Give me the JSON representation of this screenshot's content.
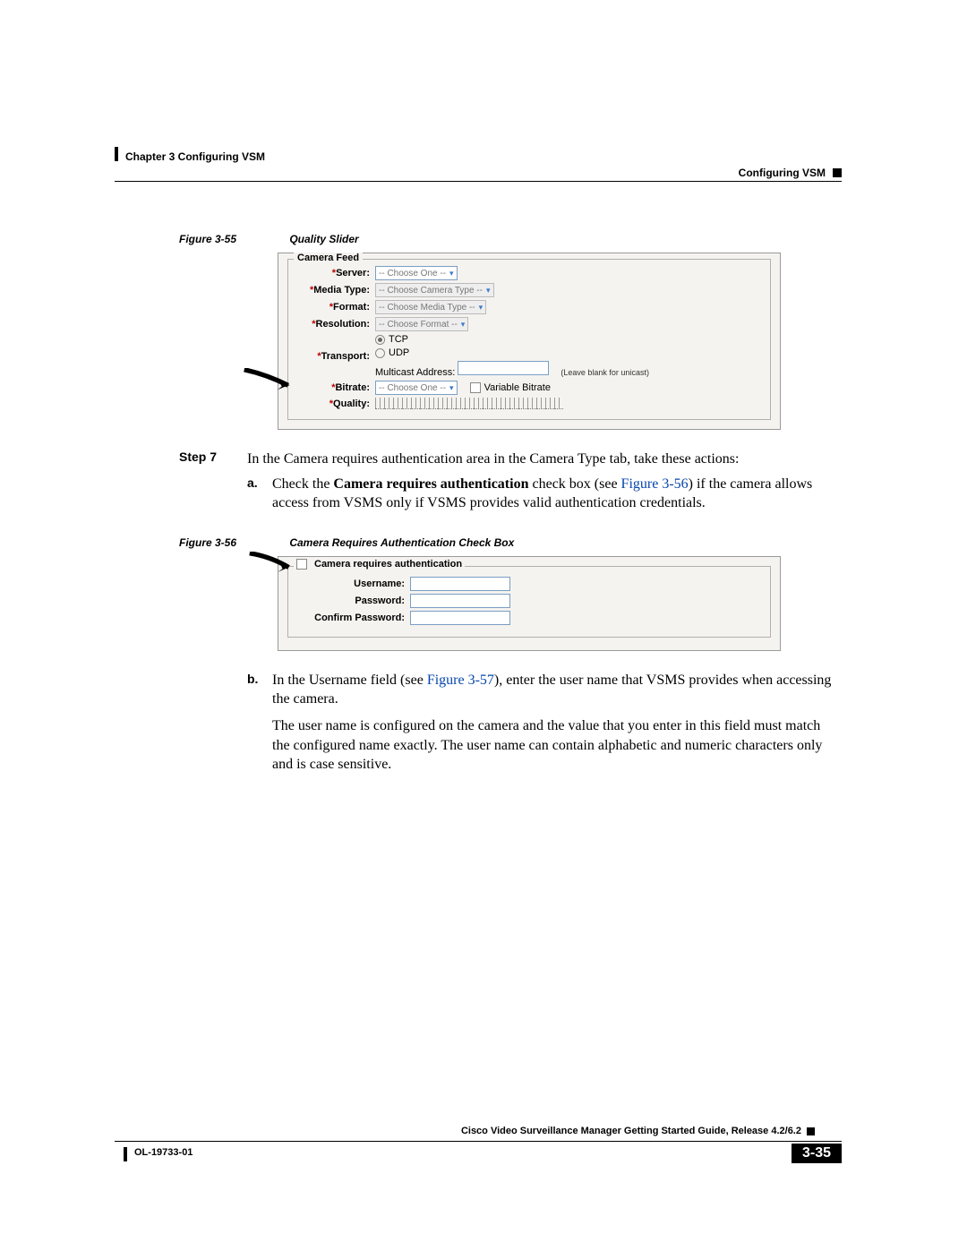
{
  "header": {
    "left": "Chapter 3      Configuring VSM",
    "right": "Configuring VSM"
  },
  "figure55": {
    "caption_num": "Figure 3-55",
    "caption_title": "Quality Slider",
    "legend": "Camera Feed",
    "rows": {
      "server_label": "Server:",
      "server_value": "-- Choose One --",
      "media_label": "Media Type:",
      "media_value": "-- Choose Camera Type --",
      "format_label": "Format:",
      "format_value": "-- Choose Media Type --",
      "resolution_label": "Resolution:",
      "resolution_value": "-- Choose Format --",
      "transport_label": "Transport:",
      "tcp": "TCP",
      "udp": "UDP",
      "multicast_label": "Multicast Address:",
      "multicast_hint": "(Leave blank for unicast)",
      "bitrate_label": "Bitrate:",
      "bitrate_value": "-- Choose One --",
      "variable_bitrate": "Variable Bitrate",
      "quality_label": "Quality:"
    }
  },
  "step7": {
    "num": "Step 7",
    "body": "In the Camera requires authentication area in the Camera Type tab, take these actions:"
  },
  "sub_a": {
    "letter": "a.",
    "pre": "Check the ",
    "bold": "Camera requires authentication",
    "mid": " check box (see ",
    "link": "Figure 3-56",
    "post": ") if the camera allows access from VSMS only if VSMS provides valid authentication credentials."
  },
  "figure56": {
    "caption_num": "Figure 3-56",
    "caption_title": "Camera Requires Authentication Check Box",
    "legend": "Camera requires authentication",
    "username_label": "Username:",
    "password_label": "Password:",
    "confirm_label": "Confirm Password:"
  },
  "sub_b": {
    "letter": "b.",
    "pre": "In the Username field (see ",
    "link": "Figure 3-57",
    "post": "), enter the user name that VSMS provides when accessing the camera."
  },
  "para2": "The user name is configured on the camera and the value that you enter in this field must match the configured name exactly. The user name can contain alphabetic and numeric characters only and is case sensitive.",
  "footer": {
    "title": "Cisco Video Surveillance Manager Getting Started Guide, Release 4.2/6.2",
    "doc": "OL-19733-01",
    "page": "3-35"
  }
}
